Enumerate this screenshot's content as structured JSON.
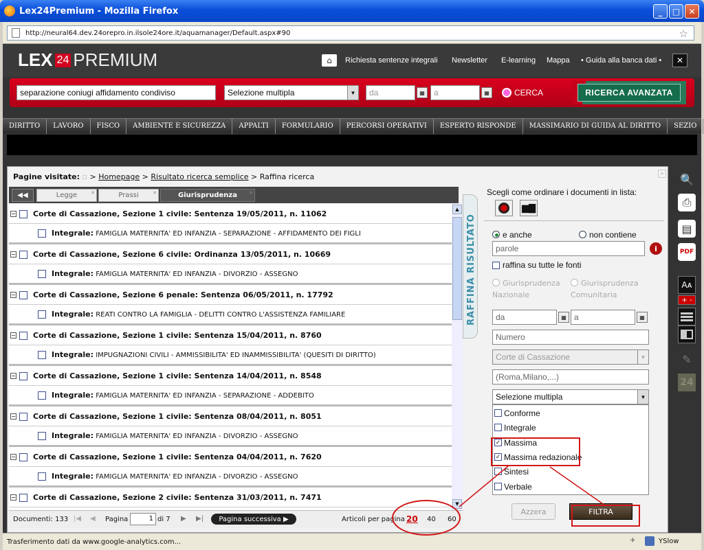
{
  "window": {
    "title": "Lex24Premium - Mozilla Firefox"
  },
  "browser": {
    "url": "http://neural64.dev.24orepro.in.ilsole24ore.it/aquamanager/Default.aspx#90",
    "status": "Trasferimento dati da www.google-analytics.com...",
    "yslow": "YSlow"
  },
  "header": {
    "logo_lex": "LEX",
    "logo_24": "24",
    "logo_premium": "PREMIUM",
    "links": [
      "Richiesta sentenze integrali",
      "Newsletter",
      "E-learning",
      "Mappa",
      "• Guida alla banca dati •"
    ]
  },
  "search": {
    "query": "separazione coniugi affidamento condiviso",
    "selection": "Selezione multipla",
    "date_from": "da",
    "date_to": "a",
    "cerca": "CERCA",
    "advanced": "RICERCA AVANZATA"
  },
  "nav": [
    "DIRITTO",
    "LAVORO",
    "FISCO",
    "AMBIENTE E SICUREZZA",
    "APPALTI",
    "FORMULARIO",
    "PERCORSI OPERATIVI",
    "ESPERTO RISPONDE",
    "MASSIMARIO DI GUIDA AL DIRITTO",
    "SEZIO"
  ],
  "breadcrumb": {
    "label": "Pagine visitate:",
    "sep": ">",
    "home": "Homepage",
    "results": "Risultato ricerca semplice",
    "current": "Raffina ricerca"
  },
  "tabs": [
    "Legge",
    "Prassi",
    "Giurisprudenza"
  ],
  "results": [
    {
      "title": "Corte di Cassazione, Sezione 1 civile: Sentenza 19/05/2011, n. 11062",
      "integrale": "FAMIGLIA MATERNITA' ED INFANZIA - SEPARAZIONE - AFFIDAMENTO DEI FIGLI"
    },
    {
      "title": "Corte di Cassazione, Sezione 6 civile: Ordinanza 13/05/2011, n. 10669",
      "integrale": "FAMIGLIA MATERNITA' ED INFANZIA - DIVORZIO - ASSEGNO"
    },
    {
      "title": "Corte di Cassazione, Sezione 6 penale: Sentenza 06/05/2011, n. 17792",
      "integrale": "REATI CONTRO LA FAMIGLIA - DELITTI CONTRO L'ASSISTENZA FAMILIARE"
    },
    {
      "title": "Corte di Cassazione, Sezione 1 civile: Sentenza 15/04/2011, n. 8760",
      "integrale": "IMPUGNAZIONI CIVILI - AMMISSIBILITA' ED INAMMISSIBILITA' (QUESITI DI DIRITTO)"
    },
    {
      "title": "Corte di Cassazione, Sezione 1 civile: Sentenza 14/04/2011, n. 8548",
      "integrale": "FAMIGLIA MATERNITA' ED INFANZIA - SEPARAZIONE - ADDEBITO"
    },
    {
      "title": "Corte di Cassazione, Sezione 1 civile: Sentenza 08/04/2011, n. 8051",
      "integrale": "FAMIGLIA MATERNITA' ED INFANZIA - DIVORZIO - ASSEGNO"
    },
    {
      "title": "Corte di Cassazione, Sezione 1 civile: Sentenza 04/04/2011, n. 7620",
      "integrale": "FAMIGLIA MATERNITA' ED INFANZIA - DIVORZIO - ASSEGNO"
    },
    {
      "title": "Corte di Cassazione, Sezione 2 civile: Sentenza 31/03/2011, n. 7471",
      "integrale": ""
    }
  ],
  "integrale_label": "Integrale:",
  "footer": {
    "documenti": "Documenti: 133",
    "pagina_label": "Pagina",
    "pagina": "1",
    "di": "di 7",
    "next": "Pagina successiva",
    "per_pagina": "Articoli per pagina",
    "sizes": [
      "20",
      "40",
      "60"
    ]
  },
  "refine": {
    "side_label": "RAFFINA RISULTATO",
    "order_label": "Scegli come ordinare i documenti in lista:",
    "opt_and": "e anche",
    "opt_not": "non contiene",
    "parole": "parole",
    "all_sources": "raffina su tutte le fonti",
    "giur_naz": "Giurisprudenza Nazionale",
    "giur_com": "Giurisprudenza Comunitaria",
    "da": "da",
    "a": "a",
    "numero": "Numero",
    "corte": "Corte di Cassazione",
    "citta": "(Roma,Milano,...)",
    "selezione": "Selezione multipla",
    "options": [
      {
        "label": "Conforme",
        "checked": false
      },
      {
        "label": "Integrale",
        "checked": false
      },
      {
        "label": "Massima",
        "checked": true
      },
      {
        "label": "Massima redazionale",
        "checked": true
      },
      {
        "label": "Sintesi",
        "checked": false
      },
      {
        "label": "Verbale",
        "checked": false
      }
    ],
    "azzera": "Azzera",
    "filtra": "FILTRA"
  },
  "colors": {
    "brand_red": "#c4001a",
    "accent_green": "#156d4b",
    "annotation_red": "#d21616"
  }
}
